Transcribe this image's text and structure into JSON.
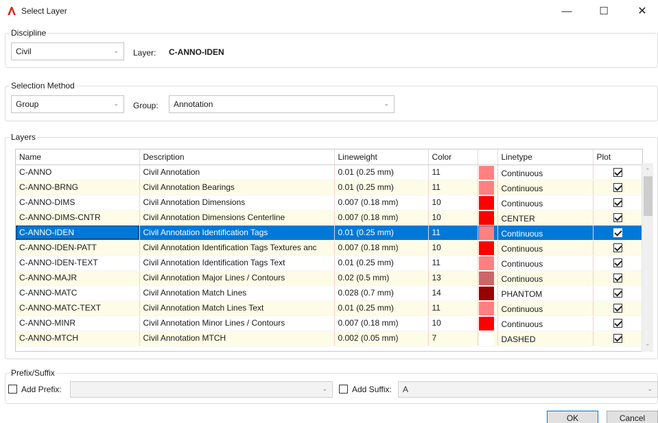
{
  "window": {
    "title": "Select Layer",
    "icon": "autocad-icon",
    "minimize": "—",
    "maximize": "☐",
    "close": "✕"
  },
  "discipline": {
    "label": "Discipline",
    "value": "Civil",
    "layer_label": "Layer:",
    "layer_value": "C-ANNO-IDEN"
  },
  "selection_method": {
    "label": "Selection Method",
    "value": "Group",
    "group_label": "Group:",
    "group_value": "Annotation"
  },
  "layers": {
    "label": "Layers",
    "columns": [
      "Name",
      "Description",
      "Lineweight",
      "Color",
      "",
      "Linetype",
      "Plot"
    ],
    "rows": [
      {
        "name": "C-ANNO",
        "description": "Civil Annotation",
        "lineweight": "0.01 (0.25 mm)",
        "color": "11",
        "swatch": "#ff8080",
        "linetype": "Continuous",
        "plot": true
      },
      {
        "name": "C-ANNO-BRNG",
        "description": "Civil Annotation Bearings",
        "lineweight": "0.01 (0.25 mm)",
        "color": "11",
        "swatch": "#ff8080",
        "linetype": "Continuous",
        "plot": true
      },
      {
        "name": "C-ANNO-DIMS",
        "description": "Civil Annotation Dimensions",
        "lineweight": "0.007 (0.18 mm)",
        "color": "10",
        "swatch": "#ff0000",
        "linetype": "Continuous",
        "plot": true
      },
      {
        "name": "C-ANNO-DIMS-CNTR",
        "description": "Civil Annotation Dimensions Centerline",
        "lineweight": "0.007 (0.18 mm)",
        "color": "10",
        "swatch": "#ff0000",
        "linetype": "CENTER",
        "plot": true
      },
      {
        "name": "C-ANNO-IDEN",
        "description": "Civil Annotation Identification Tags",
        "lineweight": "0.01 (0.25 mm)",
        "color": "11",
        "swatch": "#ff8080",
        "linetype": "Continuous",
        "plot": true
      },
      {
        "name": "C-ANNO-IDEN-PATT",
        "description": "Civil Annotation Identification Tags Textures anc",
        "lineweight": "0.007 (0.18 mm)",
        "color": "10",
        "swatch": "#ff0000",
        "linetype": "Continuous",
        "plot": true
      },
      {
        "name": "C-ANNO-IDEN-TEXT",
        "description": "Civil Annotation Identification Tags Text",
        "lineweight": "0.01 (0.25 mm)",
        "color": "11",
        "swatch": "#ff8080",
        "linetype": "Continuous",
        "plot": true
      },
      {
        "name": "C-ANNO-MAJR",
        "description": "Civil Annotation Major Lines / Contours",
        "lineweight": "0.02 (0.5 mm)",
        "color": "13",
        "swatch": "#cc6666",
        "linetype": "Continuous",
        "plot": true
      },
      {
        "name": "C-ANNO-MATC",
        "description": "Civil Annotation Match Lines",
        "lineweight": "0.028 (0.7 mm)",
        "color": "14",
        "swatch": "#990000",
        "linetype": "PHANTOM",
        "plot": true
      },
      {
        "name": "C-ANNO-MATC-TEXT",
        "description": "Civil Annotation Match Lines Text",
        "lineweight": "0.01 (0.25 mm)",
        "color": "11",
        "swatch": "#ff8080",
        "linetype": "Continuous",
        "plot": true
      },
      {
        "name": "C-ANNO-MINR",
        "description": "Civil Annotation Minor Lines / Contours",
        "lineweight": "0.007 (0.18 mm)",
        "color": "10",
        "swatch": "#ff0000",
        "linetype": "Continuous",
        "plot": true
      },
      {
        "name": "C-ANNO-MTCH",
        "description": "Civil Annotation MTCH",
        "lineweight": "0.002 (0.05 mm)",
        "color": "7",
        "swatch": "#ffffff",
        "linetype": "DASHED",
        "plot": true
      }
    ],
    "selected_index": 4
  },
  "prefix_suffix": {
    "label": "Prefix/Suffix",
    "add_prefix_label": "Add Prefix:",
    "prefix_value": "",
    "add_suffix_label": "Add Suffix:",
    "suffix_value": "A"
  },
  "buttons": {
    "ok": "OK",
    "cancel": "Cancel"
  }
}
